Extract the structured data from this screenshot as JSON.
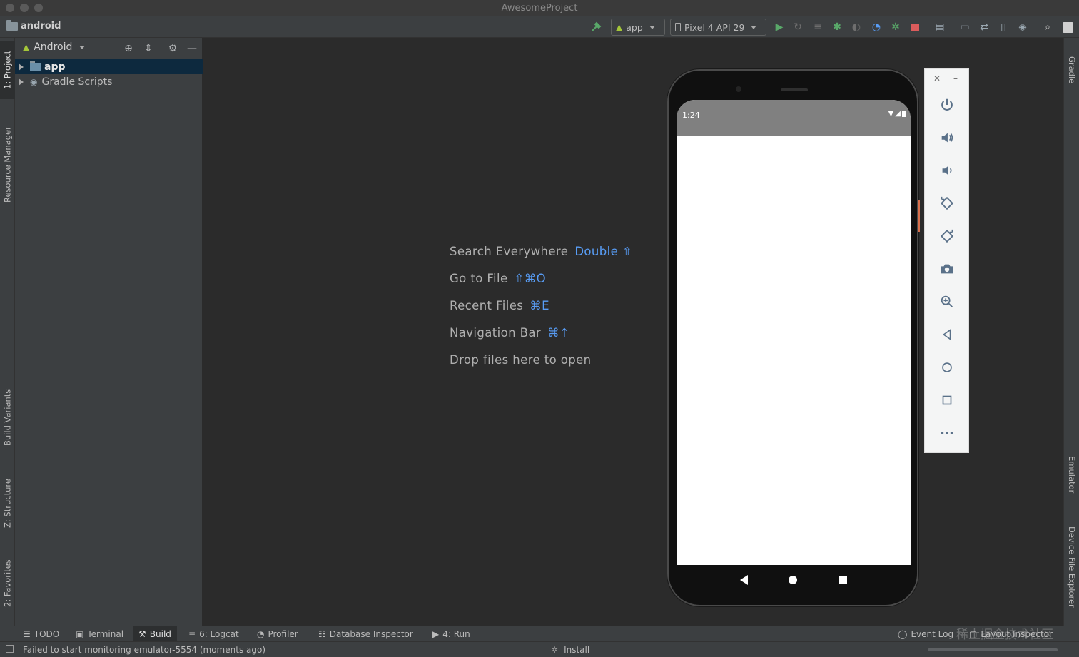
{
  "window": {
    "title": "AwesomeProject"
  },
  "breadcrumb": {
    "project": "android"
  },
  "toolbar": {
    "config_label": "app",
    "device_label": "Pixel 4 API 29"
  },
  "left_tabs": {
    "project": "1: Project",
    "resource_manager": "Resource Manager",
    "build_variants": "Build Variants",
    "structure": "Z: Structure",
    "favorites": "2: Favorites"
  },
  "right_tabs": {
    "gradle": "Gradle",
    "emulator": "Emulator",
    "device_file_explorer": "Device File Explorer"
  },
  "project_panel": {
    "view_mode": "Android",
    "tree": [
      {
        "label": "app",
        "selected": true
      },
      {
        "label": "Gradle Scripts",
        "selected": false
      }
    ]
  },
  "editor": {
    "hints": [
      {
        "label": "Search Everywhere",
        "key": "Double ⇧"
      },
      {
        "label": "Go to File",
        "key": "⇧⌘O"
      },
      {
        "label": "Recent Files",
        "key": "⌘E"
      },
      {
        "label": "Navigation Bar",
        "key": "⌘↑"
      },
      {
        "label": "Drop files here to open",
        "key": ""
      }
    ]
  },
  "emulator": {
    "status_time": "1:24",
    "controls": [
      "power-icon",
      "volume-up-icon",
      "volume-down-icon",
      "rotate-left-icon",
      "rotate-right-icon",
      "camera-icon",
      "zoom-icon",
      "back-icon",
      "home-icon",
      "overview-icon",
      "more-icon"
    ]
  },
  "bottom_tabs": {
    "todo": "TODO",
    "terminal": "Terminal",
    "build": "Build",
    "logcat_num": "6",
    "logcat": ": Logcat",
    "profiler": "Profiler",
    "database_inspector": "Database Inspector",
    "run_num": "4",
    "run": ": Run",
    "event_log": "Event Log",
    "layout_inspector": "Layout Inspector"
  },
  "status": {
    "message": "Failed to start monitoring emulator-5554 (moments ago)",
    "process": "Install"
  },
  "watermark": "稀土掘金技术社区",
  "colors": {
    "accent": "#589df6",
    "selection": "#0d293e",
    "run_green": "#59a869",
    "stop_red": "#db5c5c",
    "android_green": "#a4c639"
  }
}
